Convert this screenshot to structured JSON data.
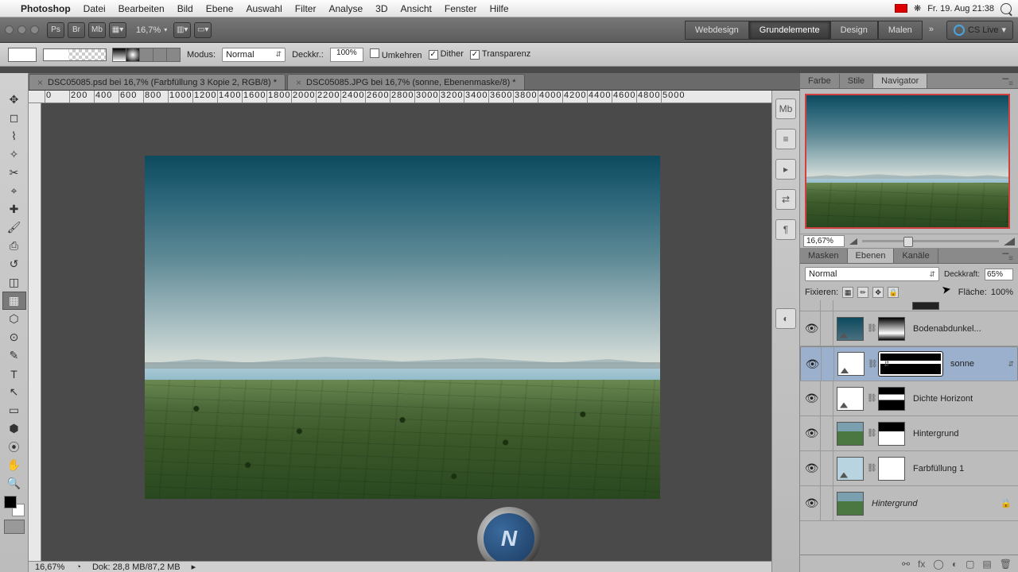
{
  "menubar": {
    "app": "Photoshop",
    "items": [
      "Datei",
      "Bearbeiten",
      "Bild",
      "Ebene",
      "Auswahl",
      "Filter",
      "Analyse",
      "3D",
      "Ansicht",
      "Fenster",
      "Hilfe"
    ],
    "clock": "Fr. 19. Aug  21:38"
  },
  "toolbar": {
    "zoom": "16,7%",
    "workspaces": [
      "Webdesign",
      "Grundelemente",
      "Design",
      "Malen"
    ],
    "workspace_active": 1,
    "cs_live": "CS Live"
  },
  "options": {
    "mode_label": "Modus:",
    "mode_value": "Normal",
    "opacity_label": "Deckkr.:",
    "opacity_value": "100%",
    "reverse": {
      "label": "Umkehren",
      "checked": false
    },
    "dither": {
      "label": "Dither",
      "checked": true
    },
    "transparency": {
      "label": "Transparenz",
      "checked": true
    }
  },
  "documents": [
    {
      "title": "DSC05085.psd bei 16,7% (Farbfüllung 3 Kopie 2, RGB/8) *"
    },
    {
      "title": "DSC05085.JPG bei 16,7% (sonne, Ebenenmaske/8) *"
    }
  ],
  "ruler_ticks": [
    "0",
    "200",
    "400",
    "600",
    "800",
    "1000",
    "1200",
    "1400",
    "1600",
    "1800",
    "2000",
    "2200",
    "2400",
    "2600",
    "2800",
    "3000",
    "3200",
    "3400",
    "3600",
    "3800",
    "4000",
    "4200",
    "4400",
    "4600",
    "4800",
    "5000"
  ],
  "status": {
    "zoom": "16,67%",
    "doc": "Dok: 28,8 MB/87,2 MB"
  },
  "panels": {
    "nav_tabs": [
      "Farbe",
      "Stile",
      "Navigator"
    ],
    "nav_active": 2,
    "nav_zoom": "16,67%",
    "layer_tabs": [
      "Masken",
      "Ebenen",
      "Kanäle"
    ],
    "layer_active": 1,
    "blend_mode": "Normal",
    "opacity_label": "Deckkraft:",
    "opacity_value": "65%",
    "lock_label": "Fixieren:",
    "fill_label": "Fläche:",
    "fill_value": "100%"
  },
  "layers": [
    {
      "name": "Bodenabdunkel...",
      "thumb": "grad-dark",
      "mask": "grad-v",
      "adj": true,
      "eye": true,
      "link": true
    },
    {
      "name": "sonne",
      "thumb": "white",
      "mask": "thin",
      "adj": true,
      "eye": true,
      "link": true,
      "selected": true,
      "mask_sel": true
    },
    {
      "name": "Dichte Horizont",
      "thumb": "white",
      "mask": "grad-h",
      "adj": true,
      "eye": true,
      "link": true
    },
    {
      "name": "Hintergrund",
      "thumb": "landscape",
      "mask": "half",
      "eye": true,
      "link": true
    },
    {
      "name": "Farbfüllung 1",
      "thumb": "fill-blue",
      "mask": "white",
      "adj": true,
      "eye": true,
      "link": true
    },
    {
      "name": "Hintergrund",
      "thumb": "landscape",
      "eye": true,
      "locked": true,
      "italic": true
    }
  ]
}
